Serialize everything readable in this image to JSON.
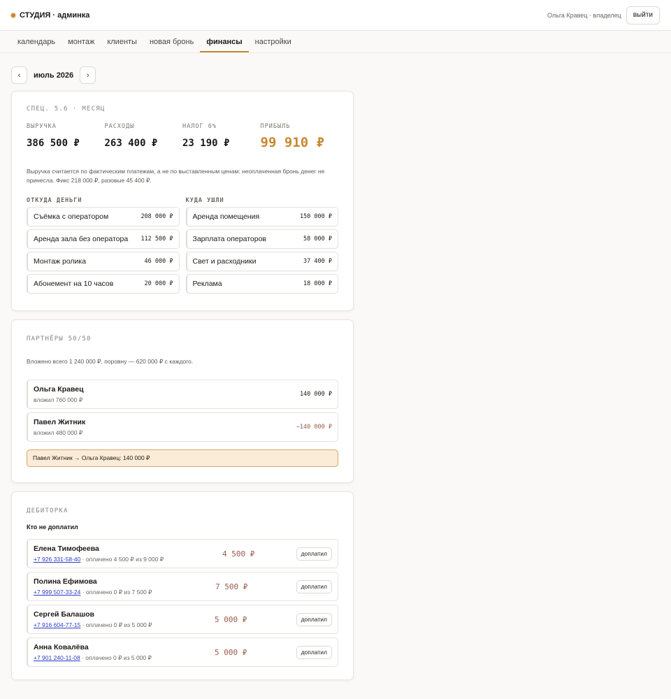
{
  "header": {
    "brand": "СТУДИЯ · админка",
    "user": "Ольга Кравец · владелец",
    "logout_label": "выйти"
  },
  "tabs": [
    {
      "label": "календарь",
      "active": false
    },
    {
      "label": "монтаж",
      "active": false
    },
    {
      "label": "клиенты",
      "active": false
    },
    {
      "label": "новая бронь",
      "active": false
    },
    {
      "label": "финансы",
      "active": true
    },
    {
      "label": "настройки",
      "active": false
    }
  ],
  "month_nav": {
    "prev_icon": "‹",
    "next_icon": "›",
    "label": "июль 2026"
  },
  "finance": {
    "title": "СПЕЦ. 5.6 · МЕСЯЦ",
    "kpis": [
      {
        "label": "ВЫРУЧКА",
        "value": "386 500 ₽"
      },
      {
        "label": "РАСХОДЫ",
        "value": "263 400 ₽"
      },
      {
        "label": "НАЛОГ 6%",
        "value": "23 190 ₽"
      },
      {
        "label": "ПРИБЫЛЬ",
        "value": "99 910 ₽"
      }
    ],
    "note": "Выручка считается по фактическим платежам, а не по выставленным ценам: неоплаченная бронь денег не принесла. Фикс 218 000 ₽, разовые 45 400 ₽.",
    "income_title": "ОТКУДА ДЕНЬГИ",
    "income": [
      {
        "name": "Съёмка с оператором",
        "amount": "208 000 ₽"
      },
      {
        "name": "Аренда зала без оператора",
        "amount": "112 500 ₽"
      },
      {
        "name": "Монтаж ролика",
        "amount": "46 000 ₽"
      },
      {
        "name": "Абонемент на 10 часов",
        "amount": "20 000 ₽"
      }
    ],
    "expense_title": "КУДА УШЛИ",
    "expenses": [
      {
        "name": "Аренда помещения",
        "amount": "150 000 ₽"
      },
      {
        "name": "Зарплата операторов",
        "amount": "58 000 ₽"
      },
      {
        "name": "Свет и расходники",
        "amount": "37 400 ₽"
      },
      {
        "name": "Реклама",
        "amount": "18 000 ₽"
      }
    ],
    "accent_color": "#c8882f"
  },
  "partners": {
    "title": "ПАРТНЁРЫ 50/50",
    "note": "Вложено всего 1 240 000 ₽, поровну — 620 000 ₽ с каждого.",
    "list": [
      {
        "name": "Ольга Кравец",
        "sub": "вложил 760 000 ₽",
        "balance": "140 000 ₽"
      },
      {
        "name": "Павел Житник",
        "sub": "вложил 480 000 ₽",
        "balance": "−140 000 ₽"
      }
    ],
    "settlement": "Павел Житник → Ольга Кравец: 140 000 ₽"
  },
  "debts": {
    "title": "ДЕБИТОРКА",
    "subtitle": "Кто не доплатил",
    "button_label": "доплатил",
    "list": [
      {
        "name": "Елена Тимофеева",
        "phone": "+7 926 331-58-40",
        "sub": " · оплачено 4 500 ₽ из 9 000 ₽",
        "amount": "4 500 ₽"
      },
      {
        "name": "Полина Ефимова",
        "phone": "+7 999 507-33-24",
        "sub": " · оплачено 0 ₽ из 7 500 ₽",
        "amount": "7 500 ₽"
      },
      {
        "name": "Сергей Балашов",
        "phone": "+7 916 604-77-15",
        "sub": " · оплачено 0 ₽ из 5 000 ₽",
        "amount": "5 000 ₽"
      },
      {
        "name": "Анна Ковалёва",
        "phone": "+7 901 240-11-08",
        "sub": " · оплачено 0 ₽ из 5 000 ₽",
        "amount": "5 000 ₽"
      }
    ]
  }
}
